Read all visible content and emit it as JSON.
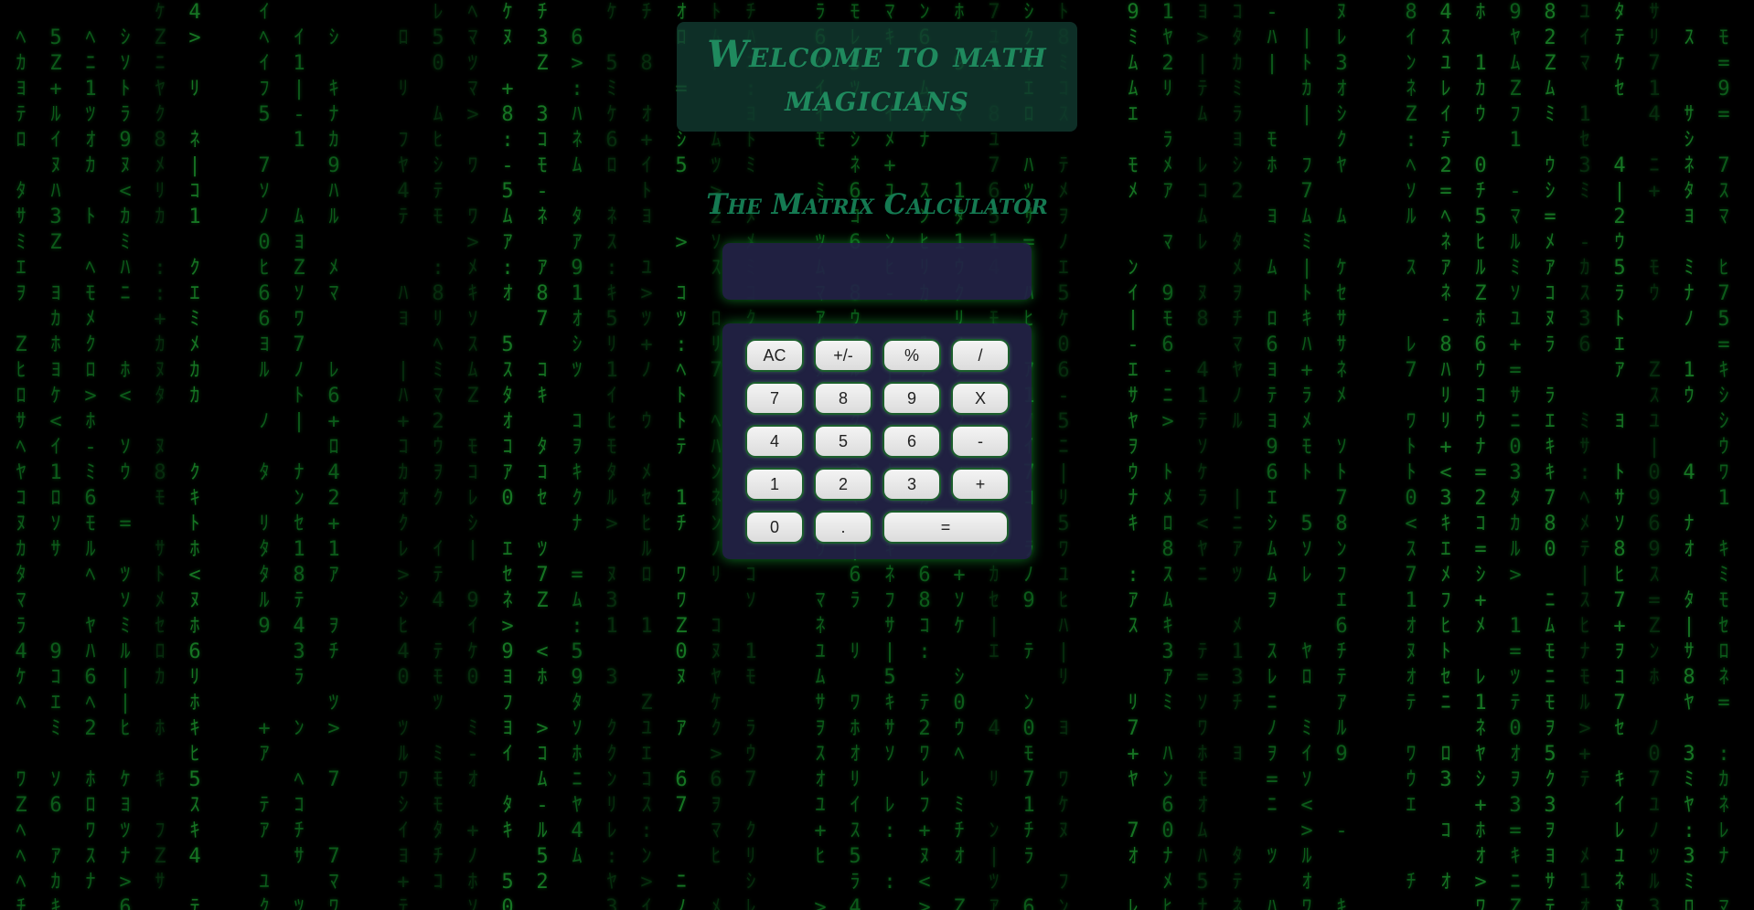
{
  "header": {
    "welcome_title": "Welcome to math magicians"
  },
  "calculator": {
    "title": "The Matrix Calculator",
    "display_value": "",
    "keys": {
      "ac": "AC",
      "plus_minus": "+/-",
      "percent": "%",
      "divide": "/",
      "seven": "7",
      "eight": "8",
      "nine": "9",
      "multiply": "X",
      "four": "4",
      "five": "5",
      "six": "6",
      "minus": "-",
      "one": "1",
      "two": "2",
      "three": "3",
      "plus": "+",
      "zero": "0",
      "dot": ".",
      "equals": "="
    }
  },
  "colors": {
    "matrix_green": "#0f6b1f",
    "title_green": "#1f8a5e",
    "panel_bg": "#232346",
    "glow": "#19c83c"
  }
}
